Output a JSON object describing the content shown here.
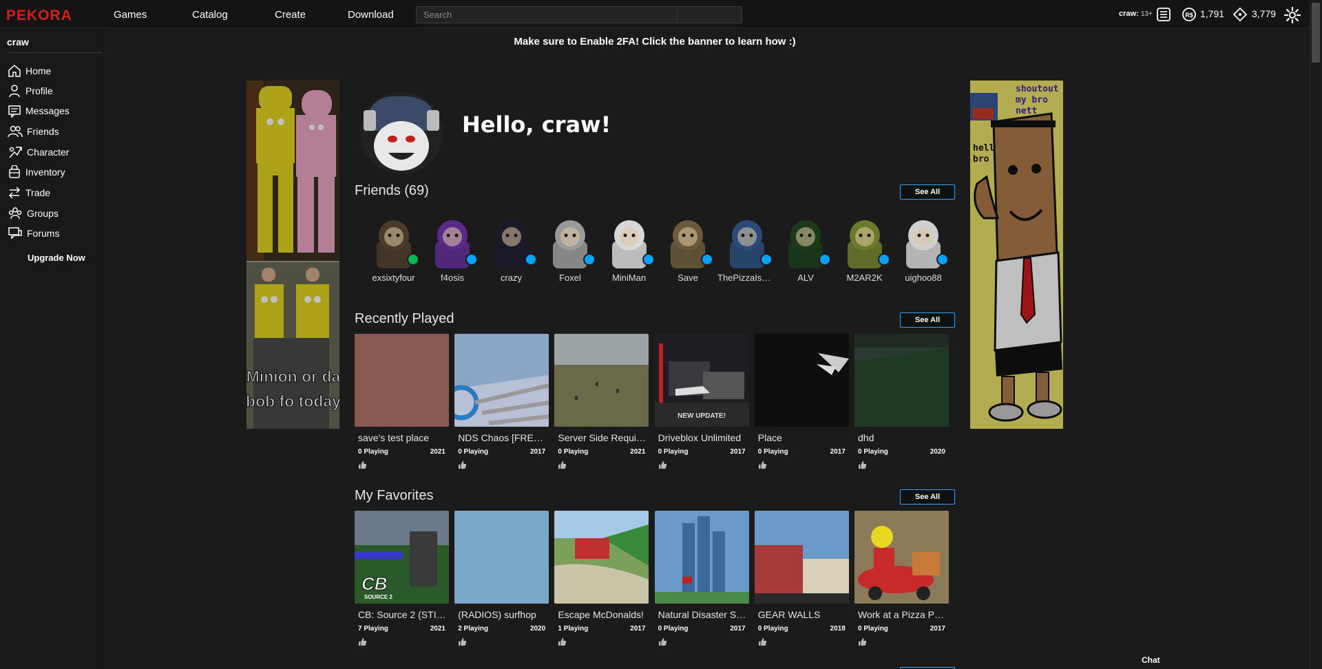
{
  "nav": {
    "logo": "PEKORA",
    "links": [
      "Games",
      "Catalog",
      "Create",
      "Download"
    ],
    "search_placeholder": "Search",
    "username": "craw:",
    "age": "13+",
    "robux": "1,791",
    "tix": "3,779"
  },
  "sidebar": {
    "username": "craw",
    "items": [
      {
        "label": "Home",
        "icon": "home-icon"
      },
      {
        "label": "Profile",
        "icon": "profile-icon"
      },
      {
        "label": "Messages",
        "icon": "messages-icon"
      },
      {
        "label": "Friends",
        "icon": "friends-icon"
      },
      {
        "label": "Character",
        "icon": "character-icon"
      },
      {
        "label": "Inventory",
        "icon": "inventory-icon"
      },
      {
        "label": "Trade",
        "icon": "trade-icon"
      },
      {
        "label": "Groups",
        "icon": "groups-icon"
      },
      {
        "label": "Forums",
        "icon": "forums-icon"
      }
    ],
    "upgrade": "Upgrade Now"
  },
  "banner": "Make sure to Enable 2FA! Click the banner to learn how :)",
  "ads": {
    "left_caption_1": "Minion or da",
    "left_caption_2": "bob fo today",
    "right_text_1": "shoutout",
    "right_text_2": "my bro",
    "right_text_3": "nett",
    "right_text_4": "hello",
    "right_text_5": "bro"
  },
  "hello": "Hello, craw!",
  "friends": {
    "title": "Friends (69)",
    "see_all": "See All",
    "list": [
      {
        "name": "exsixtyfour",
        "status": "in-game",
        "color": "#4a3a2a"
      },
      {
        "name": "f4osis",
        "status": "online",
        "color": "#5a2a8a"
      },
      {
        "name": "crazy",
        "status": "online",
        "color": "#1a1a2a"
      },
      {
        "name": "Foxel",
        "status": "online",
        "color": "#9a9a9a"
      },
      {
        "name": "MiniMan",
        "status": "online",
        "color": "#d8d8d8"
      },
      {
        "name": "Save",
        "status": "online",
        "color": "#6a5a3a"
      },
      {
        "name": "ThePizzaIsMine",
        "status": "online",
        "color": "#2a4a7a"
      },
      {
        "name": "ALV",
        "status": "online",
        "color": "#1a3a1a"
      },
      {
        "name": "M2AR2K",
        "status": "online",
        "color": "#6a7a2a"
      },
      {
        "name": "uighoo88",
        "status": "online",
        "color": "#cfcfcf"
      }
    ]
  },
  "recent": {
    "title": "Recently Played",
    "see_all": "See All",
    "games": [
      {
        "name": "save's test place",
        "playing": "0 Playing",
        "year": "2021",
        "color": "#8a5a52"
      },
      {
        "name": "NDS Chaos [FREE ...",
        "playing": "0 Playing",
        "year": "2017",
        "color": "#8aa6c4"
      },
      {
        "name": "Server Side Requir...",
        "playing": "0 Playing",
        "year": "2021",
        "color": "#6e6a52"
      },
      {
        "name": "Driveblox Unlimited",
        "playing": "0 Playing",
        "year": "2017",
        "color": "#3a3a3e"
      },
      {
        "name": "Place",
        "playing": "0 Playing",
        "year": "2017",
        "color": "#0e0e0e"
      },
      {
        "name": "dhd",
        "playing": "0 Playing",
        "year": "2020",
        "color": "#2a3a30"
      }
    ]
  },
  "favorites": {
    "title": "My Favorites",
    "see_all": "See All",
    "games": [
      {
        "name": "CB: Source 2 (STILL...",
        "playing": "7 Playing",
        "year": "2021",
        "color": "#3a5a3a"
      },
      {
        "name": "(RADIOS) surfhop",
        "playing": "2 Playing",
        "year": "2020",
        "color": "#6a9ab8"
      },
      {
        "name": "Escape McDonalds!",
        "playing": "1 Playing",
        "year": "2017",
        "color": "#7aa05a"
      },
      {
        "name": "Natural Disaster Su...",
        "playing": "0 Playing",
        "year": "2017",
        "color": "#4a6a8a"
      },
      {
        "name": "GEAR WALLS",
        "playing": "0 Playing",
        "year": "2018",
        "color": "#5a7a9a"
      },
      {
        "name": "Work at a Pizza Pla...",
        "playing": "0 Playing",
        "year": "2017",
        "color": "#9a5a3a"
      }
    ]
  },
  "thumb_overlays": {
    "driveblox": "NEW UPDATE!",
    "cb_logo": "CB",
    "cb_sub": "SOURCE 2"
  },
  "chat": "Chat"
}
